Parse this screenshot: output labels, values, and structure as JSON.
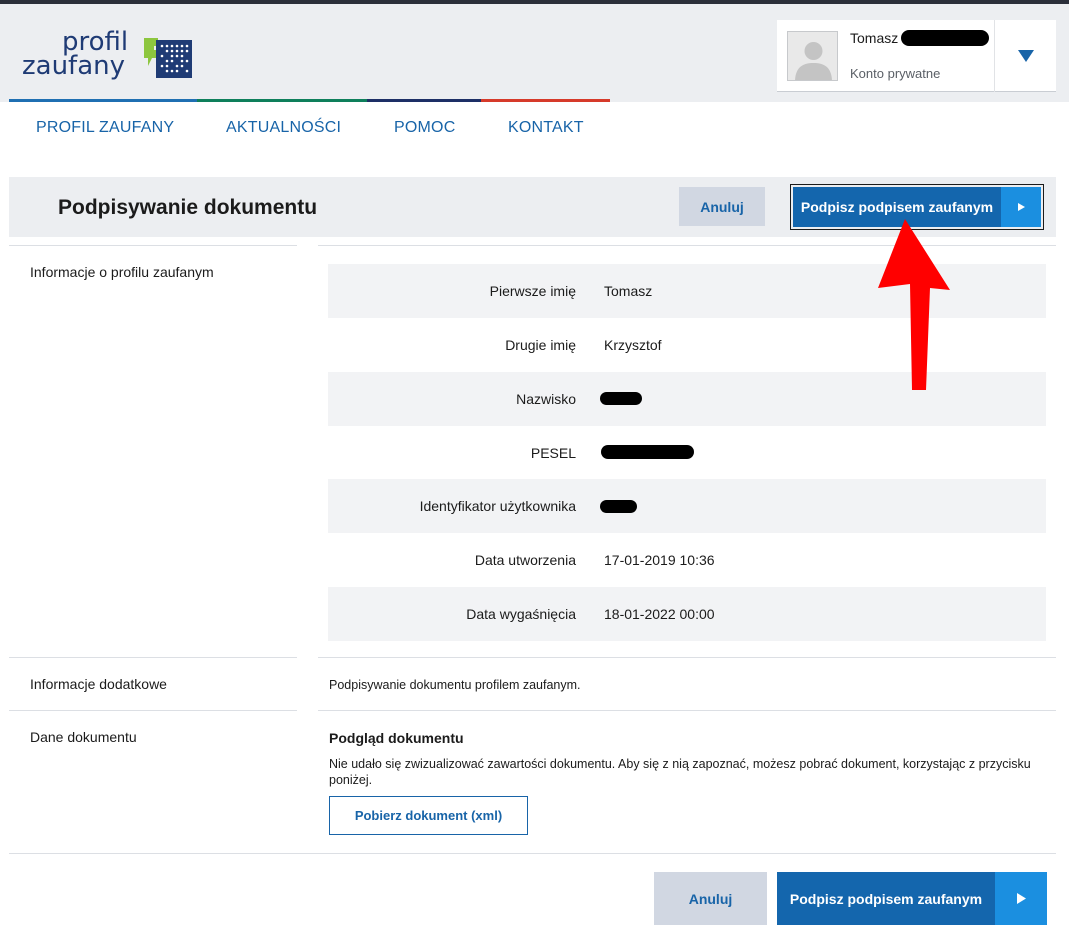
{
  "header": {
    "logo": {
      "line1": "profil",
      "line2": "zaufany",
      "mark_icon": "profil-zaufany-mark-icon"
    },
    "brand_colors": [
      "#1f3b75",
      "#0e7f5b",
      "#1d2f66",
      "#d63a2a"
    ]
  },
  "user": {
    "name": "Tomasz",
    "account_type": "Konto prywatne",
    "avatar_icon": "user-avatar-icon",
    "dropdown_icon": "triangle-down-icon"
  },
  "nav": {
    "items": [
      "PROFIL ZAUFANY",
      "AKTUALNOŚCI",
      "POMOC",
      "KONTAKT"
    ]
  },
  "titlebar": {
    "title": "Podpisywanie dokumentu",
    "cancel_label": "Anuluj",
    "sign_label": "Podpisz podpisem zaufanym",
    "sign_icon": "play-arrow-icon"
  },
  "profile_info": {
    "label": "Informacje o profilu zaufanym",
    "rows": [
      {
        "key": "Pierwsze imię",
        "value": "Tomasz"
      },
      {
        "key": "Drugie imię",
        "value": "Krzysztof"
      },
      {
        "key": "Nazwisko",
        "value": ""
      },
      {
        "key": "PESEL",
        "value": ""
      },
      {
        "key": "Identyfikator użytkownika",
        "value": ""
      },
      {
        "key": "Data utworzenia",
        "value": "17-01-2019 10:36"
      },
      {
        "key": "Data wygaśnięcia",
        "value": "18-01-2022 00:00"
      }
    ]
  },
  "extra": {
    "label": "Informacje dodatkowe",
    "text": "Podpisywanie dokumentu profilem zaufanym."
  },
  "document": {
    "label": "Dane dokumentu",
    "preview_title": "Podgląd dokumentu",
    "preview_text": "Nie udało się zwizualizować zawartości dokumentu. Aby się z nią zapoznać, możesz pobrać dokument, korzystając z przycisku poniżej.",
    "download_label": "Pobierz dokument (xml)"
  },
  "footer": {
    "cancel_label": "Anuluj",
    "sign_label": "Podpisz podpisem zaufanym",
    "sign_icon": "play-arrow-icon"
  },
  "annotation": {
    "arrow_color": "#ff0000",
    "arrow_icon": "red-arrow-icon"
  }
}
